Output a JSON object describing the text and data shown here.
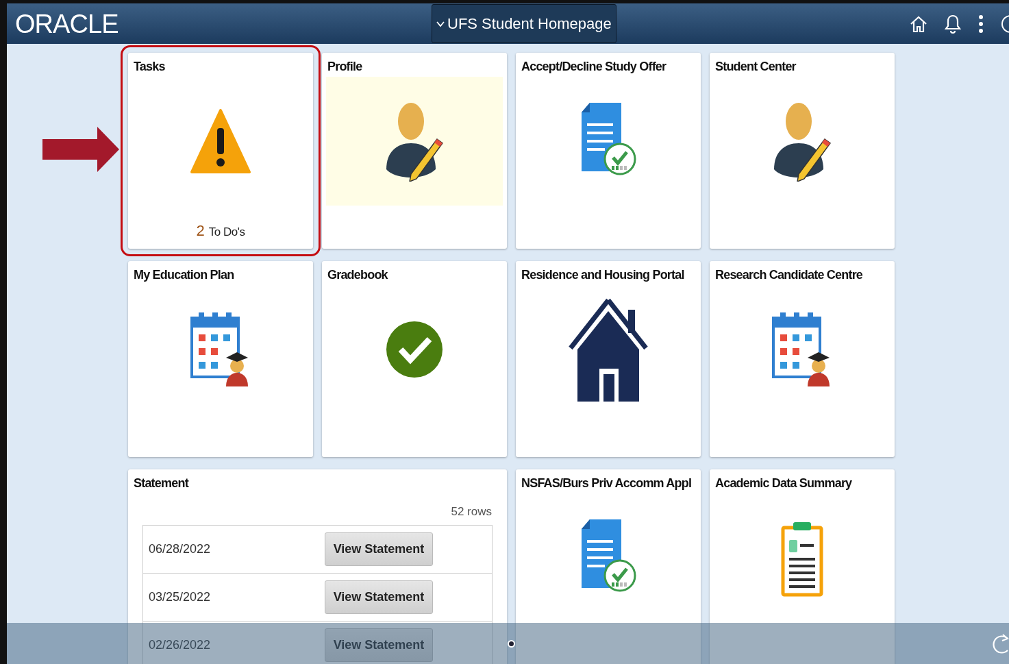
{
  "header": {
    "logo": "ORACLE",
    "page_menu": "UFS Student Homepage"
  },
  "tiles": [
    {
      "title": "Tasks",
      "kind": "tasks",
      "highlighted": true,
      "count": "2",
      "count_label": "To Do's"
    },
    {
      "title": "Profile",
      "kind": "person-edit",
      "tinted": true
    },
    {
      "title": "Accept/Decline Study Offer",
      "kind": "document-check"
    },
    {
      "title": "Student Center",
      "kind": "person-edit",
      "tinted": false
    },
    {
      "title": "My Education Plan",
      "kind": "calendar"
    },
    {
      "title": "Gradebook",
      "kind": "check-circle"
    },
    {
      "title": "Residence and Housing Portal",
      "kind": "house"
    },
    {
      "title": "Research Candidate Centre",
      "kind": "calendar"
    },
    {
      "title": "Statement",
      "kind": "statement",
      "row_count": "52 rows",
      "rows": [
        {
          "date": "06/28/2022",
          "action": "View Statement"
        },
        {
          "date": "03/25/2022",
          "action": "View Statement"
        },
        {
          "date": "02/26/2022",
          "action": "View Statement"
        }
      ]
    },
    {
      "title": "NSFAS/Burs Priv Accomm Appl",
      "kind": "document-check"
    },
    {
      "title": "Academic Data Summary",
      "kind": "clipboard"
    }
  ]
}
